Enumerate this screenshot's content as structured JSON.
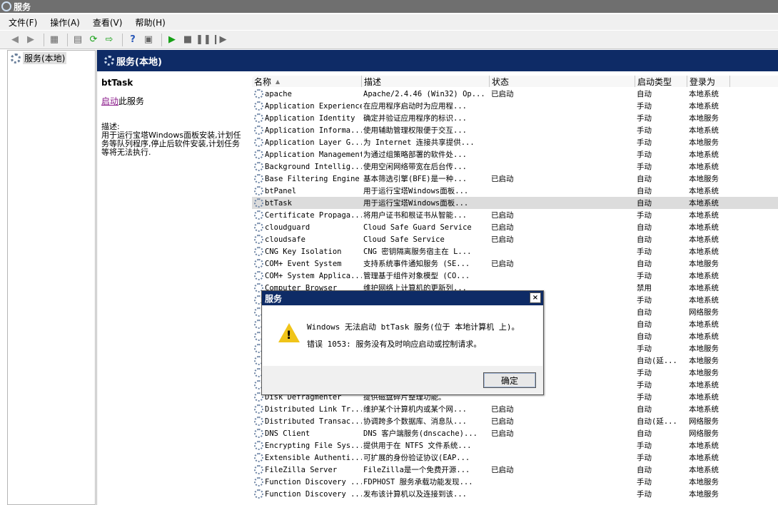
{
  "window": {
    "title": "服务"
  },
  "menu": [
    "文件(F)",
    "操作(A)",
    "查看(V)",
    "帮助(H)"
  ],
  "tree": {
    "root_label": "服务(本地)"
  },
  "content": {
    "header_title": "服务(本地)"
  },
  "detail": {
    "service_name": "btTask",
    "start_link": "启动",
    "start_suffix": "此服务",
    "desc_label": "描述:",
    "desc_text": "用于运行宝塔Windows面板安装,计划任务等队列程序,停止后软件安装,计划任务等将无法执行."
  },
  "columns": {
    "name": "名称",
    "desc": "描述",
    "status": "状态",
    "start": "启动类型",
    "logon": "登录为"
  },
  "rows": [
    {
      "name": "apache",
      "desc": "Apache/2.4.46 (Win32) Op...",
      "status": "已启动",
      "start": "自动",
      "logon": "本地系统"
    },
    {
      "name": "Application Experience",
      "desc": "在应用程序启动时为应用程...",
      "status": "",
      "start": "手动",
      "logon": "本地系统"
    },
    {
      "name": "Application Identity",
      "desc": "确定并验证应用程序的标识...",
      "status": "",
      "start": "手动",
      "logon": "本地服务"
    },
    {
      "name": "Application Informa...",
      "desc": "使用辅助管理权限便于交互...",
      "status": "",
      "start": "手动",
      "logon": "本地系统"
    },
    {
      "name": "Application Layer G...",
      "desc": "为 Internet 连接共享提供...",
      "status": "",
      "start": "手动",
      "logon": "本地服务"
    },
    {
      "name": "Application Management",
      "desc": "为通过组策略部署的软件处...",
      "status": "",
      "start": "手动",
      "logon": "本地系统"
    },
    {
      "name": "Background Intellig...",
      "desc": "使用空闲网络带宽在后台传...",
      "status": "",
      "start": "手动",
      "logon": "本地系统"
    },
    {
      "name": "Base Filtering Engine",
      "desc": "基本筛选引擎(BFE)是一种...",
      "status": "已启动",
      "start": "自动",
      "logon": "本地服务"
    },
    {
      "name": "btPanel",
      "desc": "用于运行宝塔Windows面板...",
      "status": "",
      "start": "自动",
      "logon": "本地系统"
    },
    {
      "name": "btTask",
      "desc": "用于运行宝塔Windows面板...",
      "status": "",
      "start": "自动",
      "logon": "本地系统"
    },
    {
      "name": "Certificate Propaga...",
      "desc": "将用户证书和根证书从智能...",
      "status": "已启动",
      "start": "手动",
      "logon": "本地系统"
    },
    {
      "name": "cloudguard",
      "desc": "Cloud Safe Guard Service",
      "status": "已启动",
      "start": "自动",
      "logon": "本地系统"
    },
    {
      "name": "cloudsafe",
      "desc": "Cloud Safe Service",
      "status": "已启动",
      "start": "自动",
      "logon": "本地系统"
    },
    {
      "name": "CNG Key Isolation",
      "desc": "CNG 密钥隔离服务宿主在 L...",
      "status": "",
      "start": "手动",
      "logon": "本地系统"
    },
    {
      "name": "COM+ Event System",
      "desc": "支持系统事件通知服务 (SE...",
      "status": "已启动",
      "start": "自动",
      "logon": "本地服务"
    },
    {
      "name": "COM+ System Applica...",
      "desc": "管理基于组件对象模型 (CO...",
      "status": "",
      "start": "手动",
      "logon": "本地系统"
    },
    {
      "name": "Computer Browser",
      "desc": "维护网络上计算机的更新列...",
      "status": "",
      "start": "禁用",
      "logon": "本地系统"
    },
    {
      "name": "",
      "desc": "",
      "status": "",
      "start": "手动",
      "logon": "本地系统"
    },
    {
      "name": "",
      "desc": "",
      "status": "",
      "start": "自动",
      "logon": "网络服务"
    },
    {
      "name": "",
      "desc": "",
      "status": "",
      "start": "自动",
      "logon": "本地系统"
    },
    {
      "name": "",
      "desc": "",
      "status": "",
      "start": "自动",
      "logon": "本地系统"
    },
    {
      "name": "",
      "desc": "",
      "status": "",
      "start": "手动",
      "logon": "本地服务"
    },
    {
      "name": "",
      "desc": "",
      "status": "",
      "start": "自动(延...",
      "logon": "本地服务"
    },
    {
      "name": "",
      "desc": "",
      "status": "",
      "start": "手动",
      "logon": "本地服务"
    },
    {
      "name": "",
      "desc": "",
      "status": "",
      "start": "手动",
      "logon": "本地系统"
    },
    {
      "name": "Disk Defragmenter",
      "desc": "提供磁盘碎片整理功能。",
      "status": "",
      "start": "手动",
      "logon": "本地系统"
    },
    {
      "name": "Distributed Link Tr...",
      "desc": "维护某个计算机内或某个网...",
      "status": "已启动",
      "start": "自动",
      "logon": "本地系统"
    },
    {
      "name": "Distributed Transac...",
      "desc": "协调跨多个数据库、消息队...",
      "status": "已启动",
      "start": "自动(延...",
      "logon": "网络服务"
    },
    {
      "name": "DNS Client",
      "desc": "DNS 客户端服务(dnscache)...",
      "status": "已启动",
      "start": "自动",
      "logon": "网络服务"
    },
    {
      "name": "Encrypting File Sys...",
      "desc": "提供用于在 NTFS 文件系统...",
      "status": "",
      "start": "手动",
      "logon": "本地系统"
    },
    {
      "name": "Extensible Authenti...",
      "desc": "可扩展的身份验证协议(EAP...",
      "status": "",
      "start": "手动",
      "logon": "本地系统"
    },
    {
      "name": "FileZilla Server",
      "desc": "FileZilla是一个免费开源...",
      "status": "已启动",
      "start": "自动",
      "logon": "本地系统"
    },
    {
      "name": "Function Discovery ...",
      "desc": "FDPHOST 服务承载功能发现...",
      "status": "",
      "start": "手动",
      "logon": "本地服务"
    },
    {
      "name": "Function Discovery ...",
      "desc": "发布该计算机以及连接到该...",
      "status": "",
      "start": "手动",
      "logon": "本地服务"
    }
  ],
  "dialog": {
    "title": "服务",
    "line1": "Windows 无法启动 btTask 服务(位于 本地计算机 上)。",
    "line2": "错误 1053: 服务没有及时响应启动或控制请求。",
    "ok": "确定",
    "close": "×"
  }
}
